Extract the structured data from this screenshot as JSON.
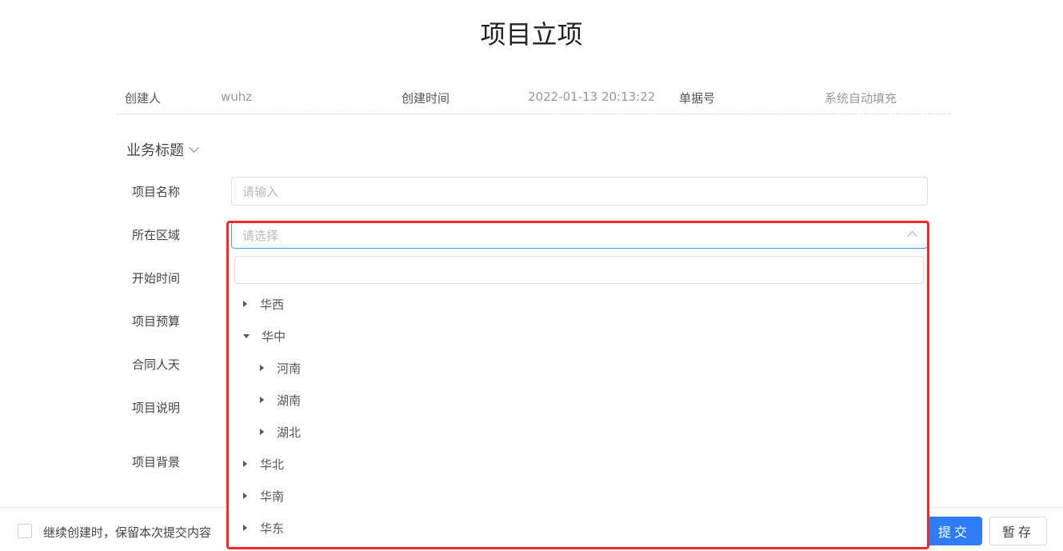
{
  "page": {
    "title": "项目立项"
  },
  "meta": {
    "creator_label": "创建人",
    "creator_value": "wuhz",
    "created_time_label": "创建时间",
    "created_time_value": "2022-01-13 20:13:22",
    "doc_no_label": "单据号",
    "doc_no_value": "系统自动填充"
  },
  "section": {
    "title": "业务标题"
  },
  "form": {
    "project_name_label": "项目名称",
    "project_name_placeholder": "请输入",
    "region_label": "所在区域",
    "region_placeholder": "请选择",
    "start_time_label": "开始时间",
    "budget_label": "项目预算",
    "contract_days_label": "合同人天",
    "description_label": "项目说明",
    "background_label": "项目背景"
  },
  "tree": {
    "search_value": "",
    "nodes": [
      {
        "label": "华西",
        "level": 0,
        "expanded": false
      },
      {
        "label": "华中",
        "level": 0,
        "expanded": true
      },
      {
        "label": "河南",
        "level": 1,
        "expanded": false
      },
      {
        "label": "湖南",
        "level": 1,
        "expanded": false
      },
      {
        "label": "湖北",
        "level": 1,
        "expanded": false
      },
      {
        "label": "华北",
        "level": 0,
        "expanded": false
      },
      {
        "label": "华南",
        "level": 0,
        "expanded": false
      },
      {
        "label": "华东",
        "level": 0,
        "expanded": false
      }
    ]
  },
  "footer": {
    "keep_content_label": "继续创建时，保留本次提交内容",
    "keep_content_checked": false,
    "submit_label": "提交",
    "save_draft_label": "暂存"
  },
  "colors": {
    "primary": "#2f7df6",
    "highlight": "#ee2a2a",
    "focus_border": "#409eff"
  }
}
